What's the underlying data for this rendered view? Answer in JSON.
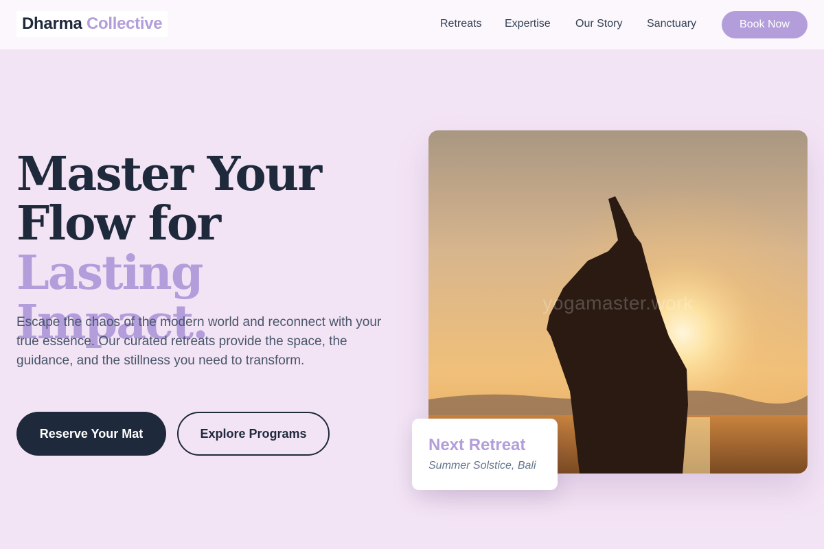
{
  "brand": {
    "name_part1": "Dharma",
    "name_part2": "Collective"
  },
  "nav": {
    "links": [
      "Retreats",
      "Expertise",
      "Our Story",
      "Sanctuary"
    ],
    "cta_label": "Book Now"
  },
  "hero": {
    "headline_line1": "Master Your",
    "headline_line2_plain": "Flow for ",
    "headline_line2_accent": "Lasting",
    "headline_line3_accent": "Impact.",
    "description": "Escape the chaos of the modern world and reconnect with your true essence. Our curated retreats provide the space, the guidance, and the stillness you need to transform.",
    "primary_button": "Reserve Your Mat",
    "secondary_button": "Explore Programs"
  },
  "image": {
    "watermark": "yogamaster.work"
  },
  "retreat_card": {
    "title": "Next Retreat",
    "subtitle": "Summer Solstice, Bali"
  },
  "colors": {
    "background": "#f3e4f5",
    "accent": "#b39ddb",
    "dark": "#1e293b"
  }
}
